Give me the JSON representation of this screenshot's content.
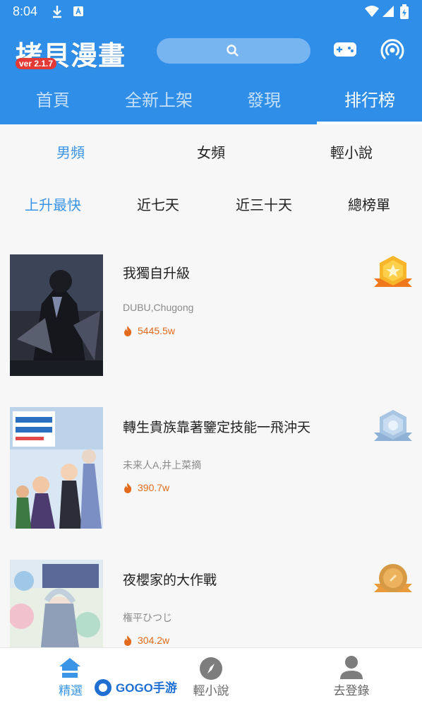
{
  "status_bar": {
    "time": "8:04"
  },
  "app": {
    "name": "拷貝漫畫",
    "version": "ver 2.1.7"
  },
  "top_tabs": [
    {
      "label": "首頁",
      "active": false
    },
    {
      "label": "全新上架",
      "active": false
    },
    {
      "label": "發現",
      "active": false
    },
    {
      "label": "排行榜",
      "active": true
    }
  ],
  "category_tabs": [
    {
      "label": "男頻",
      "active": true
    },
    {
      "label": "女頻",
      "active": false
    },
    {
      "label": "輕小說",
      "active": false
    }
  ],
  "period_tabs": [
    {
      "label": "上升最快",
      "active": true
    },
    {
      "label": "近七天",
      "active": false
    },
    {
      "label": "近三十天",
      "active": false
    },
    {
      "label": "總榜單",
      "active": false
    }
  ],
  "ranking": [
    {
      "title": "我獨自升級",
      "author": "DUBU,Chugong",
      "heat": "5445.5w",
      "medal": "gold-medal-icon"
    },
    {
      "title": "轉生貴族靠著鑒定技能一飛沖天",
      "author": "未来人A,井上菜摘",
      "heat": "390.7w",
      "medal": "silver-medal-icon"
    },
    {
      "title": "夜櫻家的大作戰",
      "author": "権平ひつじ",
      "heat": "304.2w",
      "medal": "bronze-medal-icon"
    }
  ],
  "bottom_nav": [
    {
      "label": "精選",
      "icon": "home-icon",
      "active": true
    },
    {
      "label": "輕小說",
      "icon": "compass-icon",
      "active": false
    },
    {
      "label": "去登錄",
      "icon": "user-icon",
      "active": false
    }
  ],
  "watermark": {
    "text": "GOGO手游网"
  },
  "colors": {
    "primary": "#2f8ee8",
    "accent_text": "#3b95e6",
    "heat": "#e36a1c",
    "version_badge": "#e53935"
  }
}
